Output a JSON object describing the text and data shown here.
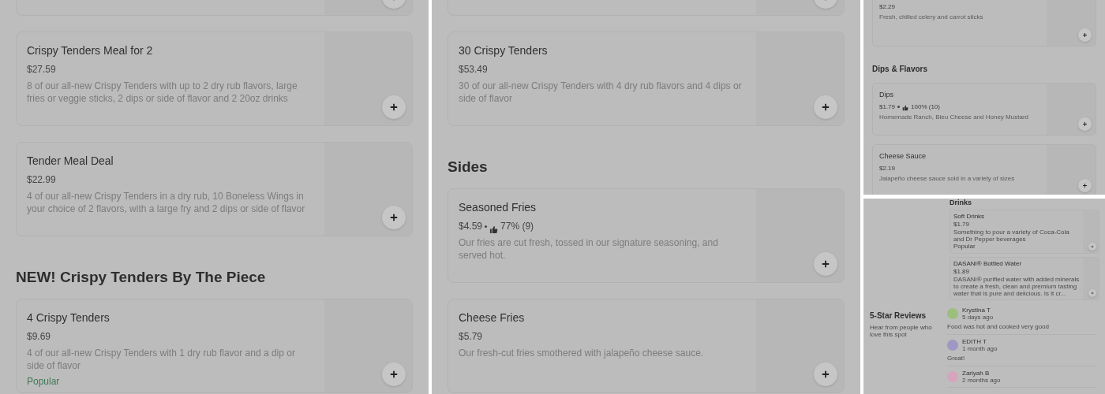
{
  "panels": [
    {
      "kind": "wide",
      "blocks": [
        {
          "kind": "stub"
        },
        {
          "kind": "card",
          "title": "Crispy Tenders Meal for 2",
          "price": "$27.59",
          "description": "8 of our all-new Crispy Tenders with up to 2 dry rub flavors, large fries or veggie sticks, 2 dips or side of flavor and 2 20oz drinks"
        },
        {
          "kind": "card",
          "title": "Tender Meal Deal",
          "price": "$22.99",
          "description": "4 of our all-new Crispy Tenders in a dry rub, 10 Boneless Wings in your choice of 2 flavors, with a large fry and 2 dips or side of flavor"
        },
        {
          "kind": "heading",
          "text": "NEW! Crispy Tenders By The Piece"
        },
        {
          "kind": "card",
          "title": "4 Crispy Tenders",
          "price": "$9.69",
          "description": "4 of our all-new Crispy Tenders with 1 dry rub flavor and a dip or side of flavor",
          "badge": "Popular"
        }
      ]
    },
    {
      "kind": "wide",
      "blocks": [
        {
          "kind": "stub"
        },
        {
          "kind": "card",
          "title": "30 Crispy Tenders",
          "price": "$53.49",
          "description": "30 of our all-new Crispy Tenders with 4 dry rub flavors and 4 dips or side of flavor"
        },
        {
          "kind": "heading",
          "text": "Sides"
        },
        {
          "kind": "card",
          "title": "Seasoned Fries",
          "price": "$4.59",
          "rating": "77% (9)",
          "description": "Our fries are cut fresh, tossed in our signature seasoning, and served hot."
        },
        {
          "kind": "card",
          "title": "Cheese Fries",
          "price": "$5.79",
          "description": "Our fresh-cut fries smothered with jalapeño cheese sauce."
        }
      ]
    },
    {
      "kind": "narrow",
      "blocks": [
        {
          "kind": "partial",
          "price": "$2.29",
          "description": "Fresh, chilled celery and carrot sticks"
        },
        {
          "kind": "heading",
          "text": "Dips & Flavors"
        },
        {
          "kind": "card",
          "title": "Dips",
          "price": "$1.79",
          "rating": "100% (10)",
          "description": "Homemade Ranch, Bleu Cheese and Honey Mustard"
        },
        {
          "kind": "card",
          "title": "Cheese Sauce",
          "price": "$2.19",
          "description": "Jalapeño cheese sauce sold in a variety of sizes"
        }
      ]
    },
    {
      "kind": "reviews",
      "section": {
        "heading": "Drinks",
        "items": [
          {
            "title": "Soft Drinks",
            "price": "$1.79",
            "description": "Something to pour a variety of Coca-Cola and Dr Pepper beverages",
            "badge": "Popular"
          },
          {
            "title": "DASANI® Bottled Water",
            "price": "$1.89",
            "description": "DASANI® purified water with added minerals to create a fresh, clean and premium tasting water that is pure and delicious. Is it cr..."
          }
        ]
      },
      "reviews": {
        "title": "5-Star Reviews",
        "subtitle": "Hear from people who love this spot",
        "items": [
          {
            "name": "Krystina T",
            "time": "5 days ago",
            "text": "Food was hot and cooked very good",
            "color": "#9cbf7e"
          },
          {
            "name": "EDITH T",
            "time": "1 month ago",
            "text": "Great!",
            "color": "#9e98c4"
          },
          {
            "name": "Zariyah B",
            "time": "2 months ago",
            "color": "#d6a4bd"
          }
        ]
      }
    }
  ]
}
